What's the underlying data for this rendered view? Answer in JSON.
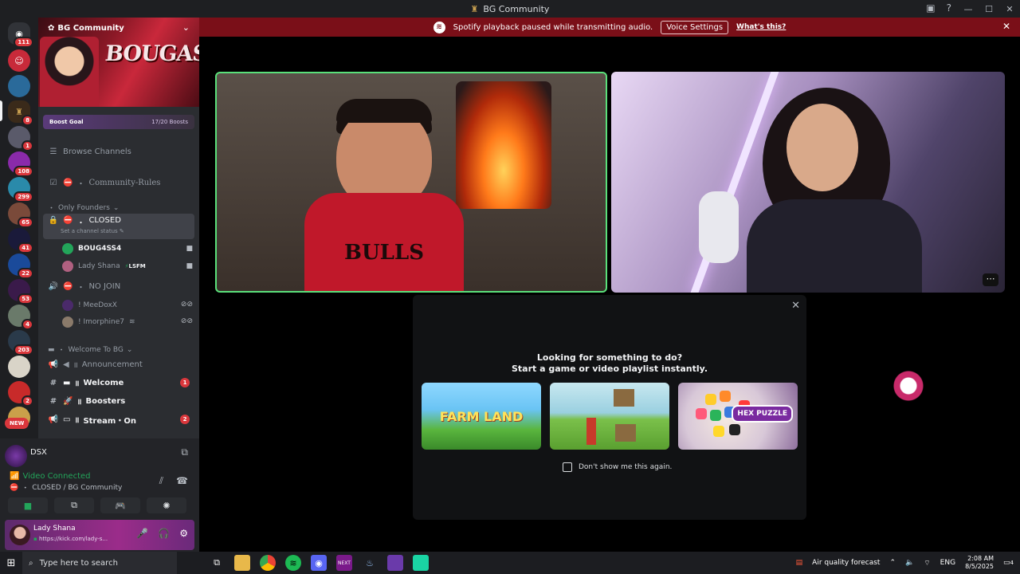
{
  "window": {
    "title": "BG Community"
  },
  "notice": {
    "message": "Spotify playback paused while transmitting audio.",
    "voice_settings": "Voice Settings",
    "whats_this": "What's this?"
  },
  "servers": {
    "badges": [
      "111",
      "8",
      "1",
      "108",
      "299",
      "65",
      "41",
      "22",
      "53",
      "4",
      "203",
      "2"
    ],
    "new_label": "NEW"
  },
  "server": {
    "name": "BG Community",
    "banner_text": "BOUGASSAA",
    "boost_goal": "Boost Goal",
    "boost_count": "17/20 Boosts"
  },
  "channels": {
    "browse": "Browse Channels",
    "rules": "Community-Rules",
    "cat_founders": "Only Founders",
    "closed": "CLOSED",
    "closed_status": "Set a channel status",
    "user1": "BOUG4SS4",
    "user2": "Lady Shana",
    "user2_tag": "LSFM",
    "nojoin": "NO JOIN",
    "user3": "! MeeDoxX",
    "user4": "! Imorphine7",
    "cat_welcome": "Welcome To BG",
    "announcement": "Announcement",
    "welcome": "Welcome",
    "welcome_count": "1",
    "boosters": "Boosters",
    "stream": "Stream・On",
    "stream_count": "2"
  },
  "voice": {
    "server_short": "DSX",
    "connected": "Video Connected",
    "channel": "CLOSED / BG Community"
  },
  "user": {
    "name": "Lady Shana",
    "status": "https://kick.com/lady-s..."
  },
  "activity": {
    "line1": "Looking for something to do?",
    "line2": "Start a game or video playlist instantly.",
    "game1": "FARM LAND",
    "game3": "HEX PUZZLE",
    "dont_show": "Don't show me this again."
  },
  "stage": {
    "jersey_text": "BULLS"
  },
  "taskbar": {
    "search": "Type here to search",
    "weather": "Air quality forecast",
    "lang": "ENG",
    "time": "2:08 AM",
    "date": "8/5/2025",
    "notif_count": "4"
  }
}
